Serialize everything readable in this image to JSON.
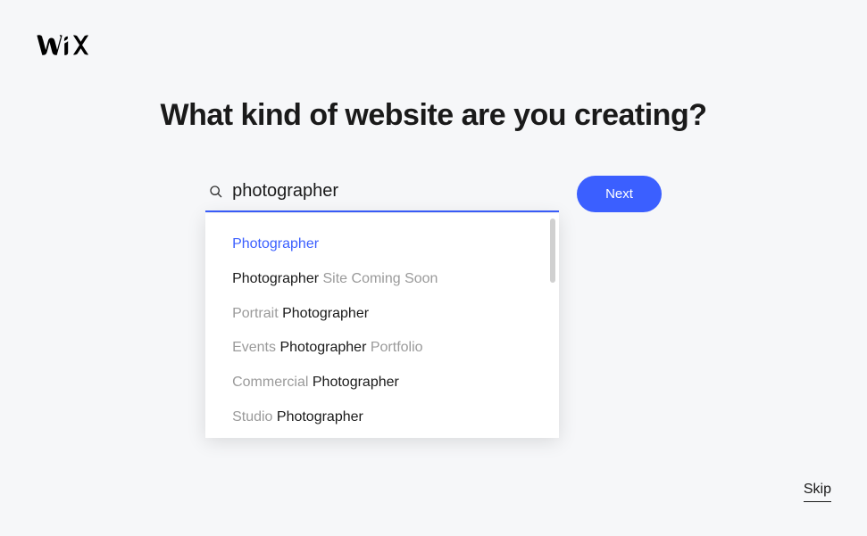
{
  "logo": "WIX",
  "heading": "What kind of website are you creating?",
  "search": {
    "value": "photographer",
    "placeholder": ""
  },
  "next_label": "Next",
  "skip_label": "Skip",
  "suggestions": [
    {
      "parts": [
        {
          "text": "Photographer",
          "match": true
        }
      ],
      "selected": true
    },
    {
      "parts": [
        {
          "text": "Photographer",
          "match": true
        },
        {
          "text": " Site Coming Soon",
          "match": false
        }
      ],
      "selected": false
    },
    {
      "parts": [
        {
          "text": "Portrait ",
          "match": false
        },
        {
          "text": "Photographer",
          "match": true
        }
      ],
      "selected": false
    },
    {
      "parts": [
        {
          "text": "Events ",
          "match": false
        },
        {
          "text": "Photographer",
          "match": true
        },
        {
          "text": " Portfolio",
          "match": false
        }
      ],
      "selected": false
    },
    {
      "parts": [
        {
          "text": "Commercial ",
          "match": false
        },
        {
          "text": "Photographer",
          "match": true
        }
      ],
      "selected": false
    },
    {
      "parts": [
        {
          "text": "Studio ",
          "match": false
        },
        {
          "text": "Photographer",
          "match": true
        }
      ],
      "selected": false
    }
  ]
}
